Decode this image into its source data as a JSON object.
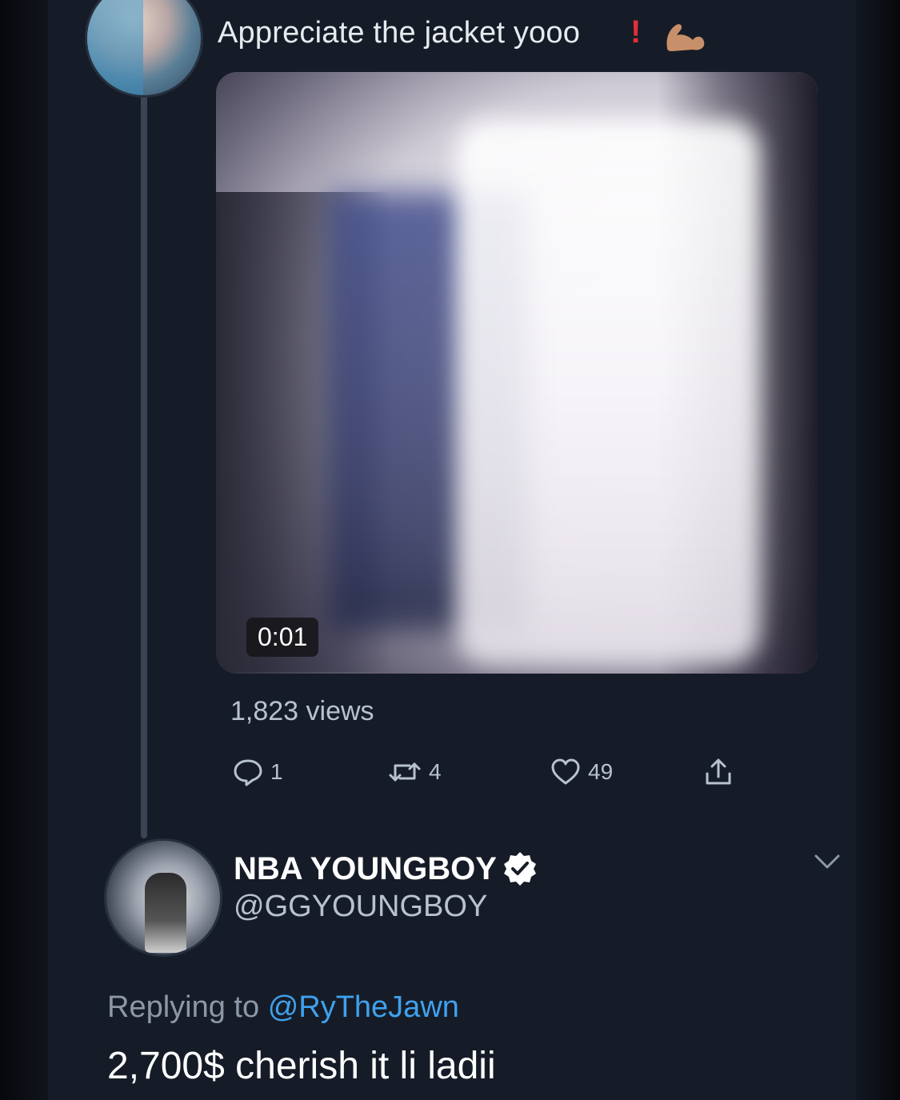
{
  "parent_tweet": {
    "text": "Appreciate the jacket yooo",
    "exclaim": "!",
    "media": {
      "timestamp": "0:01"
    },
    "views": "1,823 views",
    "actions": {
      "reply_count": "1",
      "retweet_count": "4",
      "like_count": "49"
    }
  },
  "reply_tweet": {
    "author_name": "NBA YOUNGBOY",
    "handle": "@GGYOUNGBOY",
    "replying_prefix": "Replying to",
    "replying_mention": "@RyTheJawn",
    "text": "2,700$ cherish it li ladii"
  },
  "colors": {
    "background": "#161c27",
    "text_primary": "#ffffff",
    "text_secondary": "#b8c2cf",
    "mention": "#3fa1ee",
    "exclaim": "#e0303a"
  },
  "icons": [
    "muscle-icon",
    "reply-icon",
    "retweet-icon",
    "like-icon",
    "share-icon",
    "verified-icon",
    "chevron-down-icon"
  ]
}
